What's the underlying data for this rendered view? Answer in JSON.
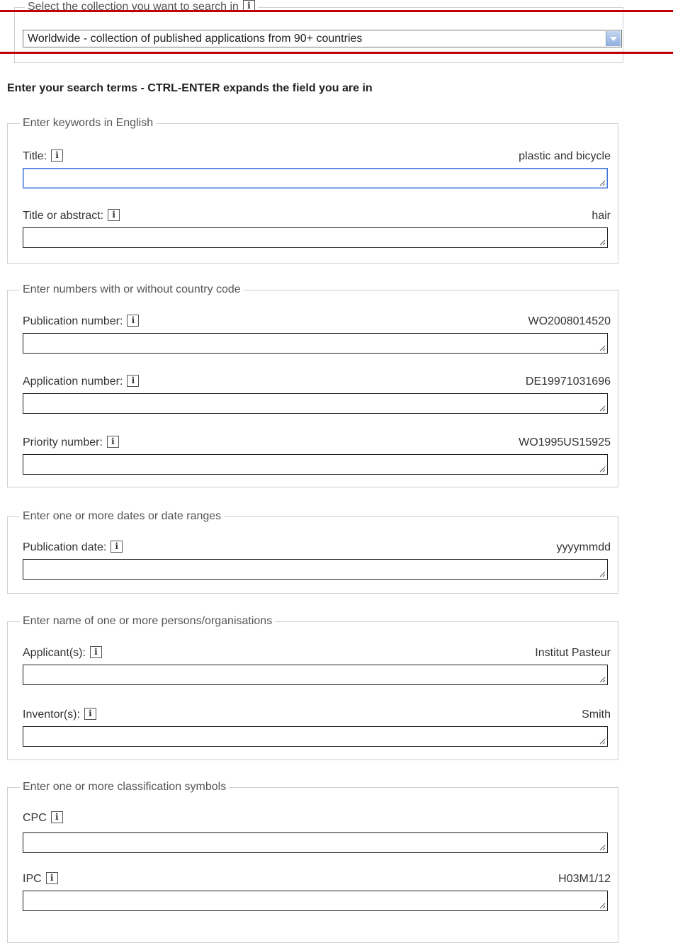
{
  "collection": {
    "legend": "Select the collection you want to search in",
    "selected": "Worldwide - collection of published applications from 90+ countries"
  },
  "heading": "Enter your search terms - CTRL-ENTER expands the field you are in",
  "info_glyph": "i",
  "sections": {
    "keywords": {
      "legend": "Enter keywords in English",
      "title": {
        "label": "Title:",
        "hint": "plastic and bicycle"
      },
      "title_abstract": {
        "label": "Title or abstract:",
        "hint": "hair"
      }
    },
    "numbers": {
      "legend": "Enter numbers with or without country code",
      "publication": {
        "label": "Publication number:",
        "hint": "WO2008014520"
      },
      "application": {
        "label": "Application number:",
        "hint": "DE19971031696"
      },
      "priority": {
        "label": "Priority number:",
        "hint": "WO1995US15925"
      }
    },
    "dates": {
      "legend": "Enter one or more dates or date ranges",
      "publication_date": {
        "label": "Publication date:",
        "hint": "yyyymmdd"
      }
    },
    "names": {
      "legend": "Enter name of one or more persons/organisations",
      "applicants": {
        "label": "Applicant(s):",
        "hint": "Institut Pasteur"
      },
      "inventors": {
        "label": "Inventor(s):",
        "hint": "Smith"
      }
    },
    "classification": {
      "legend": "Enter one or more classification symbols",
      "cpc": {
        "label": "CPC",
        "hint": ""
      },
      "ipc": {
        "label": "IPC",
        "hint": "H03M1/12"
      }
    }
  },
  "colors": {
    "accent_line": "#c00000",
    "focus_border": "#3a6fd8"
  }
}
